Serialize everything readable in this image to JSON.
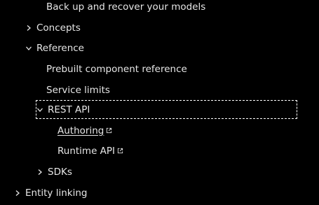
{
  "nav": {
    "backup_label": "Back up and recover your models",
    "concepts_label": "Concepts",
    "reference_label": "Reference",
    "prebuilt_label": "Prebuilt component reference",
    "service_limits_label": "Service limits",
    "rest_api_label": "REST API",
    "authoring_label": "Authoring",
    "runtime_api_label": "Runtime API",
    "sdks_label": "SDKs",
    "entity_linking_label": "Entity linking"
  },
  "colors": {
    "background": "#000000",
    "text": "#e6e6e6",
    "focus_outline": "#ffffff"
  },
  "icons": {
    "collapsed": "chevron-right-icon",
    "expanded": "chevron-down-icon",
    "external": "external-link-icon"
  }
}
